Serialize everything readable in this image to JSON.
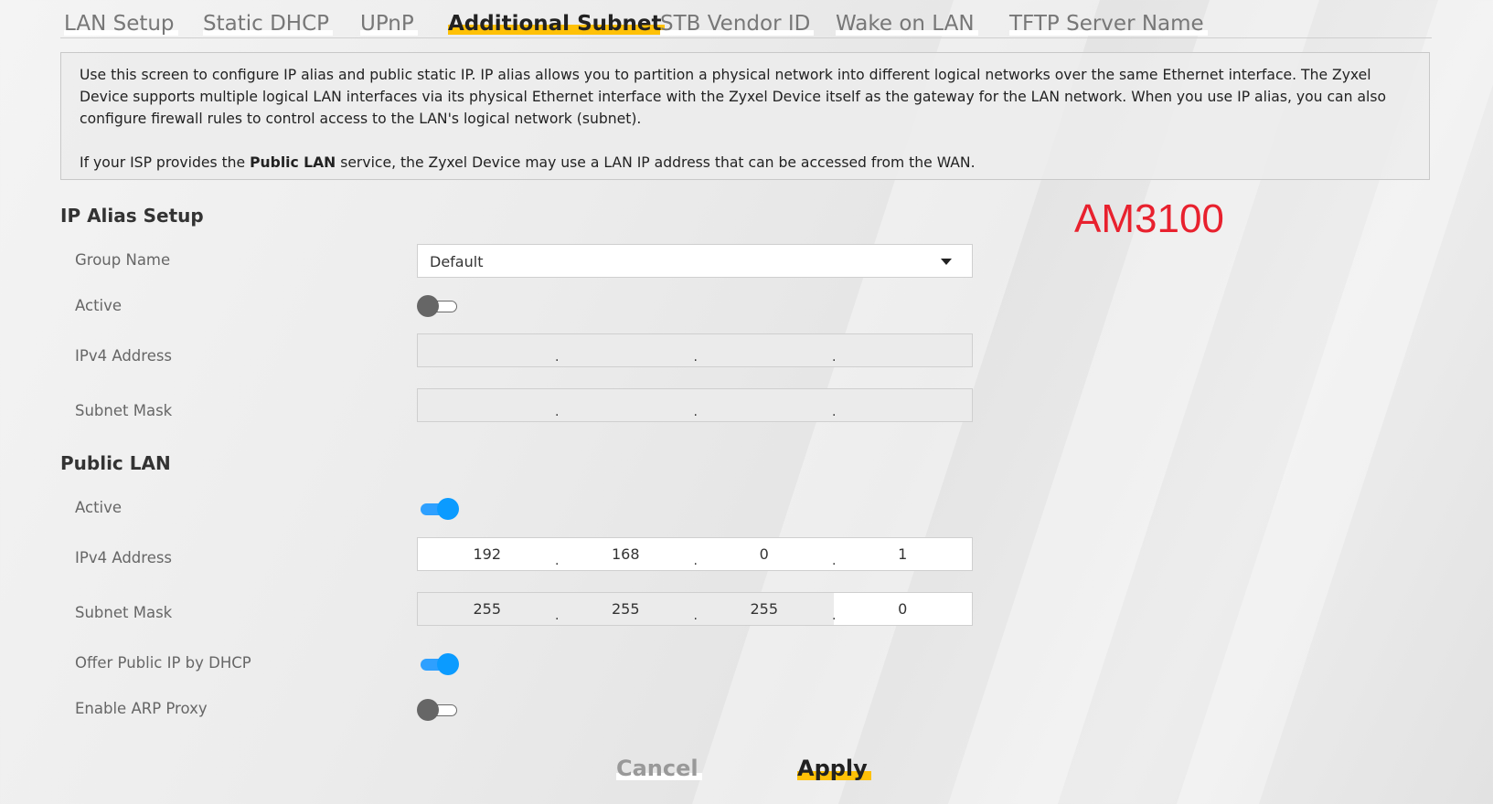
{
  "tabs": [
    {
      "label": "LAN Setup",
      "active": false
    },
    {
      "label": "Static DHCP",
      "active": false
    },
    {
      "label": "UPnP",
      "active": false
    },
    {
      "label": "Additional Subnet",
      "active": true
    },
    {
      "label": "STB Vendor ID",
      "active": false
    },
    {
      "label": "Wake on LAN",
      "active": false
    },
    {
      "label": "TFTP Server Name",
      "active": false
    }
  ],
  "description": {
    "paragraph1": "Use this screen to configure IP alias and public static IP. IP alias allows you to partition a physical network into different logical networks over the same Ethernet interface. The Zyxel Device supports multiple logical LAN interfaces via its physical Ethernet interface with the Zyxel Device itself as the gateway for the LAN network. When you use IP alias, you can also configure firewall rules to control access to the LAN's logical network (subnet).",
    "paragraph2_pre": "If your ISP provides the ",
    "paragraph2_bold": "Public LAN",
    "paragraph2_post": " service, the Zyxel Device may use a LAN IP address that can be accessed from the WAN."
  },
  "brand_label": "AM3100",
  "ip_alias": {
    "title": "IP Alias Setup",
    "group_name_label": "Group Name",
    "group_name_value": "Default",
    "active_label": "Active",
    "active": false,
    "ipv4_label": "IPv4 Address",
    "ipv4": [
      "",
      "",
      "",
      ""
    ],
    "subnet_label": "Subnet Mask",
    "subnet": [
      "",
      "",
      "",
      ""
    ]
  },
  "public_lan": {
    "title": "Public LAN",
    "active_label": "Active",
    "active": true,
    "ipv4_label": "IPv4 Address",
    "ipv4": [
      "192",
      "168",
      "0",
      "1"
    ],
    "subnet_label": "Subnet Mask",
    "subnet": [
      "255",
      "255",
      "255",
      "0"
    ],
    "offer_dhcp_label": "Offer Public IP by DHCP",
    "offer_dhcp": true,
    "arp_proxy_label": "Enable ARP Proxy",
    "arp_proxy": false
  },
  "buttons": {
    "cancel": "Cancel",
    "apply": "Apply"
  },
  "colors": {
    "accent": "#ffc107",
    "toggle_on": "#0b9bff",
    "brand": "#e8212e"
  }
}
